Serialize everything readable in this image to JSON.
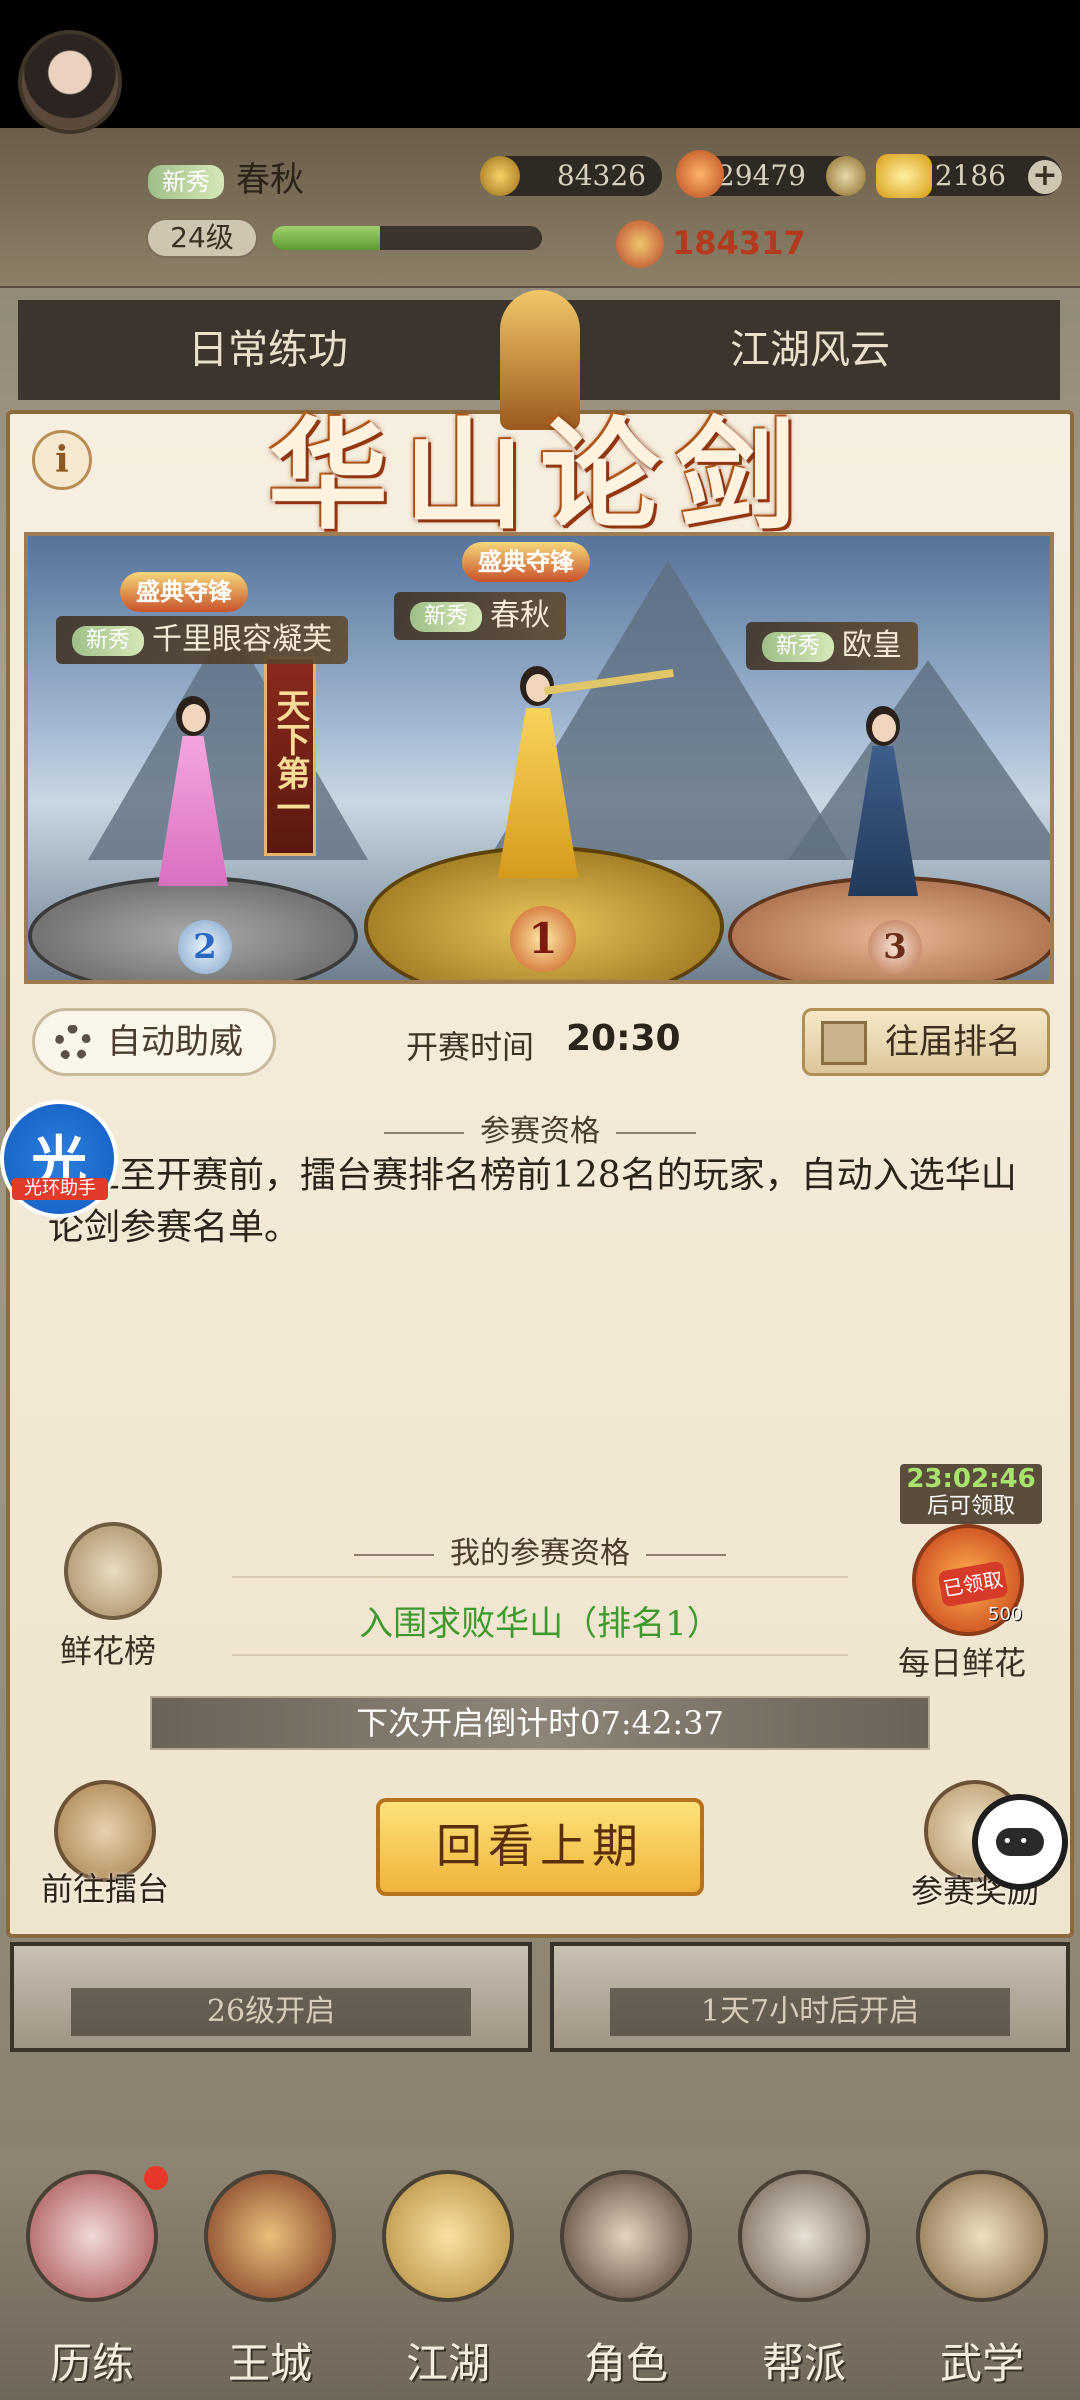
{
  "player": {
    "rank_tag": "新秀",
    "name": "春秋",
    "level": "24级",
    "exp_fraction": 0.4,
    "power": "184317"
  },
  "currencies": {
    "coins": "84326",
    "vitality": "29479",
    "gold": "2186"
  },
  "background_tabs": [
    "日常练功",
    "江湖风云"
  ],
  "panel": {
    "title": "华山论剑",
    "info_icon": "i",
    "podium": {
      "crown_label": "盛典夺锋",
      "first_banner": "天下第一",
      "first": {
        "tag": "新秀",
        "name": "春秋",
        "rank": "1"
      },
      "second": {
        "tag": "新秀",
        "name": "千里眼容凝芙",
        "rank": "2"
      },
      "third": {
        "tag": "新秀",
        "name": "欧皇",
        "rank": "3"
      }
    },
    "auto_cheer_label": "自动助威",
    "start_time_label": "开赛时间",
    "start_time": "20:30",
    "past_ranking_label": "往届排名",
    "qualification_header": "参赛资格",
    "qualification_text": "截止至开赛前，擂台赛排名榜前128名的玩家，自动入选华山论剑参赛名单。",
    "flower_board_label": "鲜花榜",
    "my_qualification_header": "我的参赛资格",
    "my_qualification_value": "入围求败华山（排名1）",
    "daily_flower": {
      "countdown": "23:02:46",
      "countdown_note": "后可领取",
      "claimed_tag": "已领取",
      "count": "500",
      "label": "每日鲜花"
    },
    "next_open_countdown": "下次开启倒计时07:42:37",
    "review_button_label": "回看上期",
    "go_arena_label": "前往擂台",
    "entry_reward_label": "参赛奖励"
  },
  "overlay": {
    "guang_char": "光",
    "guang_label": "光环助手"
  },
  "locked_banners": [
    "26级开启",
    "1天7小时后开启"
  ],
  "bottom_nav": [
    "历练",
    "王城",
    "江湖",
    "角色",
    "帮派",
    "武学"
  ],
  "colors": {
    "panel_bg": "#f6efdf",
    "accent_gold": "#f0b33a",
    "qualify_green": "#3e9a2f",
    "countdown_green": "#a9e36e",
    "notify_red": "#e8382a"
  },
  "icons": [
    "avatar",
    "coin-icon",
    "vitality-icon",
    "gold-icon",
    "plus-icon",
    "power-icon",
    "info-icon",
    "gear-icon",
    "ranking-icon",
    "flower-board-icon",
    "daily-flower-icon",
    "arena-icon",
    "reward-icon",
    "chat-icon"
  ]
}
